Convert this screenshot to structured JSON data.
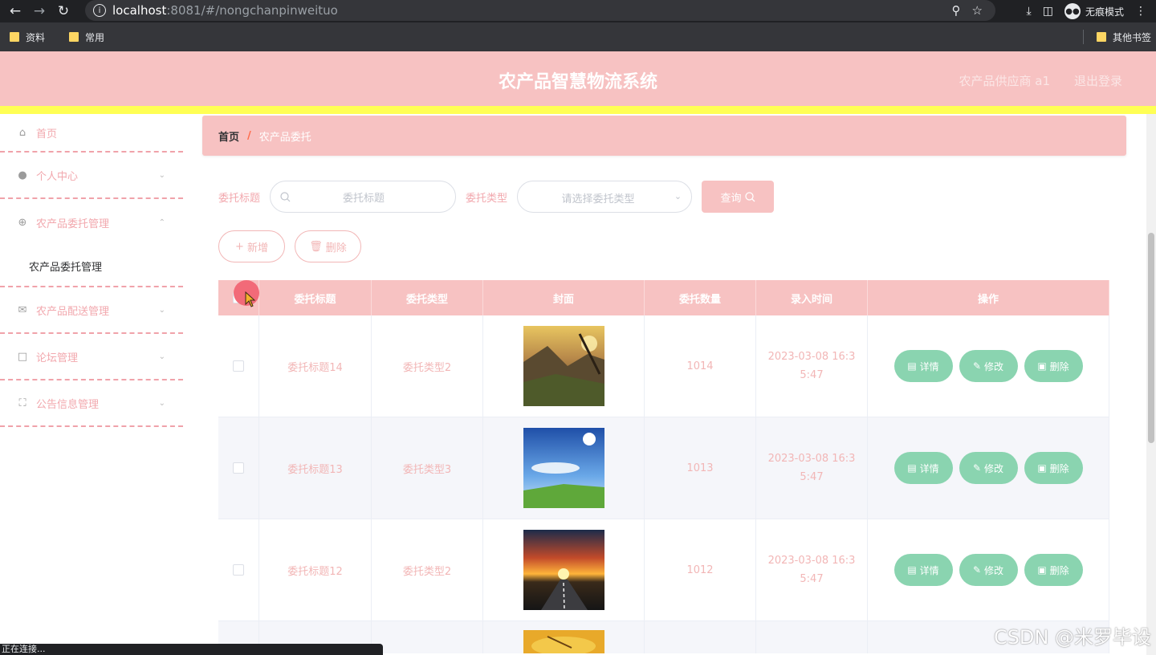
{
  "browser": {
    "url_host": "localhost",
    "url_path": ":8081/#/nongchanpinweituo",
    "incognito_label": "无痕模式",
    "bookmarks": [
      "资料",
      "常用"
    ],
    "other_bookmarks": "其他书签",
    "status_text": "正在连接..."
  },
  "header": {
    "title": "农产品智慧物流系统",
    "user": "农产品供应商 a1",
    "logout": "退出登录"
  },
  "sidebar": {
    "items": [
      {
        "label": "首页",
        "icon": "home-icon"
      },
      {
        "label": "个人中心",
        "icon": "user-icon"
      },
      {
        "label": "农产品委托管理",
        "icon": "target-icon"
      },
      {
        "label": "农产品配送管理",
        "icon": "mail-icon"
      },
      {
        "label": "论坛管理",
        "icon": "chat-icon"
      },
      {
        "label": "公告信息管理",
        "icon": "scan-icon"
      }
    ],
    "submenu": "农产品委托管理"
  },
  "breadcrumb": {
    "home": "首页",
    "separator": "/",
    "current": "农产品委托"
  },
  "search": {
    "title_label": "委托标题",
    "title_placeholder": "委托标题",
    "type_label": "委托类型",
    "type_placeholder": "请选择委托类型",
    "query_button": "查询"
  },
  "actions": {
    "add": "新增",
    "delete": "删除"
  },
  "table": {
    "headers": [
      "委托标题",
      "委托类型",
      "封面",
      "委托数量",
      "录入时间",
      "操作"
    ],
    "rows": [
      {
        "title": "委托标题14",
        "type": "委托类型2",
        "cover": "mountain-sunset",
        "quantity": "1014",
        "time": "2023-03-08 16:35:47"
      },
      {
        "title": "委托标题13",
        "type": "委托类型3",
        "cover": "blue-sky-meadow",
        "quantity": "1013",
        "time": "2023-03-08 16:35:47"
      },
      {
        "title": "委托标题12",
        "type": "委托类型2",
        "cover": "road-sunset",
        "quantity": "1012",
        "time": "2023-03-08 16:35:47"
      }
    ],
    "op_buttons": {
      "detail": "详情",
      "edit": "修改",
      "delete": "删除"
    }
  },
  "watermark": "CSDN @米罗毕设",
  "colors": {
    "header_pink": "#f7c2c2",
    "accent_yellow": "#ffff55",
    "op_green": "#8ad4b0",
    "text_pink": "#f2a8ae"
  }
}
